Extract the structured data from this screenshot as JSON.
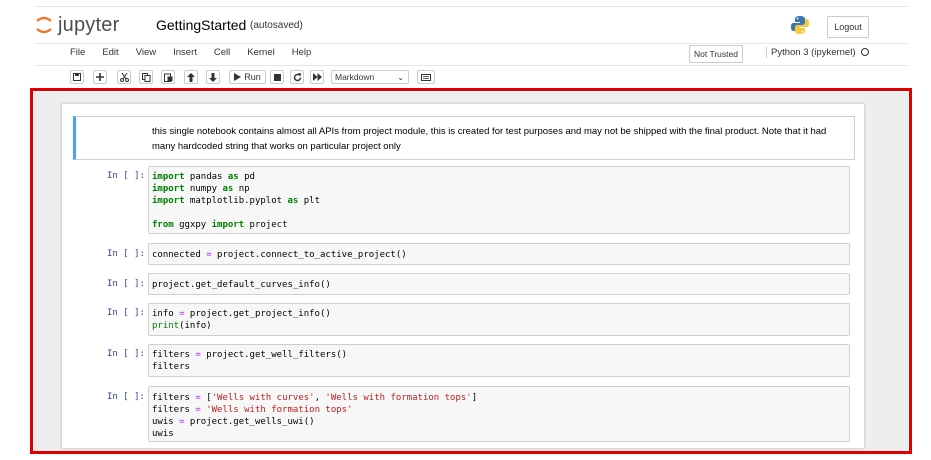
{
  "header": {
    "logo_text": "jupyter",
    "notebook_title": "GettingStarted",
    "autosave_status": "(autosaved)",
    "logout_label": "Logout"
  },
  "menu": {
    "items": [
      "File",
      "Edit",
      "View",
      "Insert",
      "Cell",
      "Kernel",
      "Help"
    ],
    "trust_label": "Not Trusted",
    "kernel_name": "Python 3 (ipykernel)"
  },
  "toolbar": {
    "run_label": "Run",
    "cell_type": "Markdown"
  },
  "cells": {
    "markdown_text": "this single notebook contains almost all APIs from project module, this is created for test purposes and may not be shipped with the final product. Note that it had many hardcoded string that works on particular project only",
    "prompt": "In [ ]:",
    "c1": {
      "l1": [
        "import",
        " pandas ",
        "as",
        " pd"
      ],
      "l2": [
        "import",
        " numpy ",
        "as",
        " np"
      ],
      "l3": [
        "import",
        " matplotlib.pyplot ",
        "as",
        " plt"
      ],
      "l5": [
        "from",
        " ggxpy ",
        "import",
        " project"
      ]
    },
    "c2": [
      "connected ",
      "=",
      " project.connect_to_active_project()"
    ],
    "c3": "project.get_default_curves_info()",
    "c4": {
      "l1": [
        "info ",
        "=",
        " project.get_project_info()"
      ],
      "l2": [
        "print",
        "(info)"
      ]
    },
    "c5": {
      "l1": [
        "filters ",
        "=",
        " project.get_well_filters()"
      ],
      "l2": "filters"
    },
    "c6": {
      "l1": [
        "filters ",
        "=",
        " [",
        "'Wells with curves'",
        ", ",
        "'Wells with formation tops'",
        "]"
      ],
      "l2": [
        "filters ",
        "=",
        " ",
        "'Wells with formation tops'"
      ],
      "l3": [
        "uwis ",
        "=",
        " project.get_wells_uwi()"
      ],
      "l4": "uwis"
    }
  },
  "colors": {
    "highlight_border": "#e00000",
    "markdown_selected_bar": "#42a5f5",
    "prompt": "#303f9f",
    "keyword": "#008000",
    "operator": "#aa22ff",
    "string": "#ba2121"
  }
}
